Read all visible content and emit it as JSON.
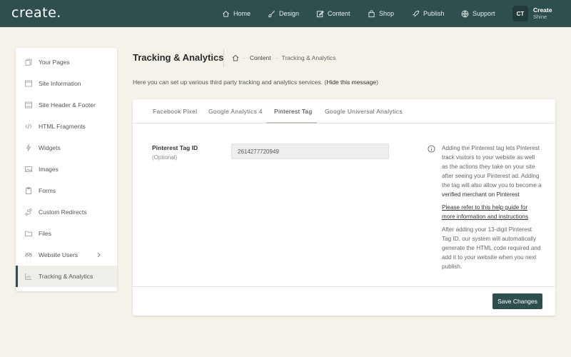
{
  "app": {
    "logo": "create."
  },
  "nav": [
    {
      "label": "Home",
      "icon": "home-icon"
    },
    {
      "label": "Design",
      "icon": "brush-icon"
    },
    {
      "label": "Content",
      "icon": "edit-icon"
    },
    {
      "label": "Shop",
      "icon": "shopping-bag-icon"
    },
    {
      "label": "Publish",
      "icon": "rocket-icon"
    },
    {
      "label": "Support",
      "icon": "globe-icon"
    }
  ],
  "account": {
    "initials": "CT",
    "name": "Create",
    "subtitle": "Shine"
  },
  "sidebar": {
    "items": [
      {
        "label": "Your Pages",
        "icon": "pages-icon"
      },
      {
        "label": "Site Information",
        "icon": "browser-icon"
      },
      {
        "label": "Site Header & Footer",
        "icon": "browser-icon"
      },
      {
        "label": "HTML Fragments",
        "icon": "code-icon"
      },
      {
        "label": "Widgets",
        "icon": "bolt-icon"
      },
      {
        "label": "Images",
        "icon": "image-icon"
      },
      {
        "label": "Forms",
        "icon": "clipboard-icon"
      },
      {
        "label": "Custom Redirects",
        "icon": "route-icon"
      },
      {
        "label": "Files",
        "icon": "folder-icon"
      },
      {
        "label": "Website Users",
        "icon": "users-icon"
      },
      {
        "label": "Tracking & Analytics",
        "icon": "chart-icon"
      }
    ],
    "active": "Tracking & Analytics"
  },
  "header": {
    "title": "Tracking & Analytics",
    "breadcrumb": {
      "section": "Content",
      "current": "Tracking & Analytics"
    },
    "intro_text": "Here you can set up various third party tracking and analytics services. (",
    "intro_link": "Hide this message",
    "intro_close": ")"
  },
  "tabs": [
    {
      "label": "Facebook  Pixel"
    },
    {
      "label": "Google  Analytics 4"
    },
    {
      "label": "Pinterest  Tag"
    },
    {
      "label": "Google  Universal  Analytics"
    }
  ],
  "active_tab": "Pinterest  Tag",
  "form": {
    "label": "Pinterest Tag ID",
    "sublabel": "(Optional)",
    "value": "2614277720949"
  },
  "help": {
    "p1_text": "Adding the Pinterest tag lets Pinterest track visitors to your website as well as the actions they take on your site after seeing your Pinterest ad. Adding the tag will also allow you to become a ",
    "p1_bold": "verified merchant on Pinterest",
    "link": "Please refer to this help guide for more information and instructions",
    "p2": "After adding your 13-digit Pinterest Tag ID, our system will automatically generate the HTML code required and add it to your website when you next publish."
  },
  "save_label": "Save Changes",
  "colors": {
    "primary": "#2f4f4e",
    "background": "#f5f2ea"
  }
}
